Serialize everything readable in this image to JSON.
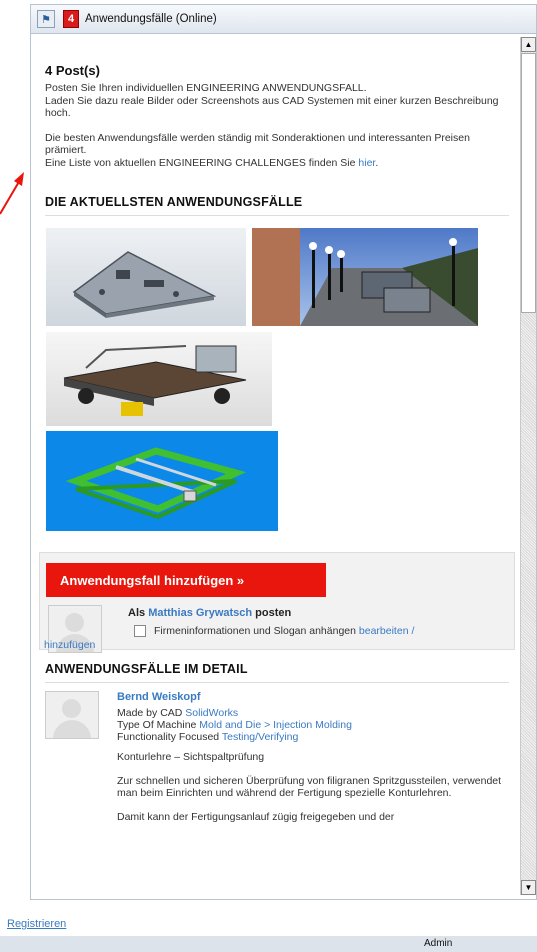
{
  "window": {
    "title": "Anwendungsfälle (Online)",
    "badge_count": "4"
  },
  "intro": {
    "posts_heading": "4 Post(s)",
    "p1_line1": "Posten Sie Ihren individuellen ENGINEERING ANWENDUNGSFALL.",
    "p1_line2": "Laden Sie dazu reale Bilder oder Screenshots aus CAD Systemen mit einer kurzen Beschreibung hoch.",
    "p2_line1": "Die besten Anwendungsfälle werden ständig mit Sonderaktionen und interessanten Preisen prämiert.",
    "p2_line2": "Eine Liste von aktuellen ENGINEERING CHALLENGES finden Sie",
    "p2_link": "hier",
    "p2_end": "."
  },
  "latest": {
    "heading": "DIE AKTUELLSTEN ANWENDUNGSFÄLLE"
  },
  "add": {
    "button_label": "Anwendungsfall hinzufügen »",
    "post_as_prefix": "Als",
    "post_as_user": "Matthias Grywatsch",
    "post_as_suffix": "posten",
    "checkbox_label": "Firmeninformationen und Slogan anhängen",
    "edit_link_part1": "bearbeiten /",
    "edit_link_part2": "hinzufügen"
  },
  "detail": {
    "heading": "ANWENDUNGSFÄLLE IM DETAIL",
    "author": "Bernd Weiskopf",
    "made_by_label": "Made by CAD",
    "made_by_value": "SolidWorks",
    "machine_label": "Type Of Machine",
    "machine_value": "Mold and Die > Injection Molding",
    "func_label": "Functionality Focused",
    "func_value": "Testing/Verifying",
    "subtitle": "Konturlehre – Sichtspaltprüfung",
    "body1": "Zur schnellen und sicheren Überprüfung von filigranen Spritzgussteilen, verwendet man beim Einrichten und während der Fertigung spezielle Konturlehren.",
    "body2": "Damit kann der Fertigungsanlauf zügig freigegeben und der"
  },
  "footer": {
    "register_link": "Registrieren",
    "status_user": "Admin"
  },
  "colors": {
    "accent_red": "#e8160c",
    "link_blue": "#3a7ac2"
  }
}
